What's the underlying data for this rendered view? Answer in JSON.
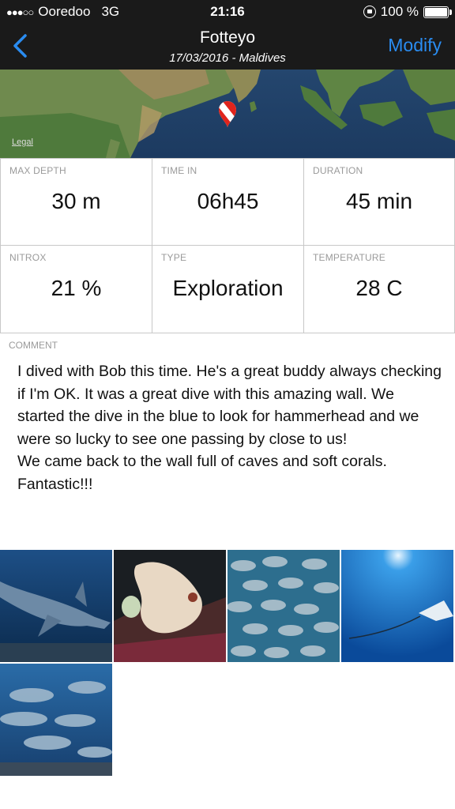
{
  "status_bar": {
    "signal_dots": "●●●○○",
    "carrier": "Ooredoo",
    "network": "3G",
    "time": "21:16",
    "battery_percent": "100 %"
  },
  "nav": {
    "title": "Fotteyo",
    "subtitle": "17/03/2016 - Maldives",
    "modify_label": "Modify",
    "accent_color": "#2a8cf0"
  },
  "map": {
    "legal_label": "Legal",
    "marker_icon": "dive-flag-pin-icon"
  },
  "stats": [
    {
      "label": "MAX DEPTH",
      "value": "30 m"
    },
    {
      "label": "TIME IN",
      "value": "06h45"
    },
    {
      "label": "DURATION",
      "value": "45 min"
    },
    {
      "label": "NITROX",
      "value": "21 %"
    },
    {
      "label": "TYPE",
      "value": "Exploration"
    },
    {
      "label": "TEMPERATURE",
      "value": "28 C"
    }
  ],
  "comment": {
    "label": "COMMENT",
    "text": "I dived with Bob this time. He's a great buddy always checking if I'm OK. It was a great dive with this amazing wall. We started the dive in the blue to look for hammerhead and we were so lucky to see one passing by close to us!\nWe came back to the wall full of caves and soft corals. Fantastic!!!"
  },
  "photos": [
    {
      "subject": "hammerhead-shark"
    },
    {
      "subject": "leaf-scorpionfish"
    },
    {
      "subject": "fish-school"
    },
    {
      "subject": "eagle-ray"
    },
    {
      "subject": "trevally-school"
    }
  ]
}
